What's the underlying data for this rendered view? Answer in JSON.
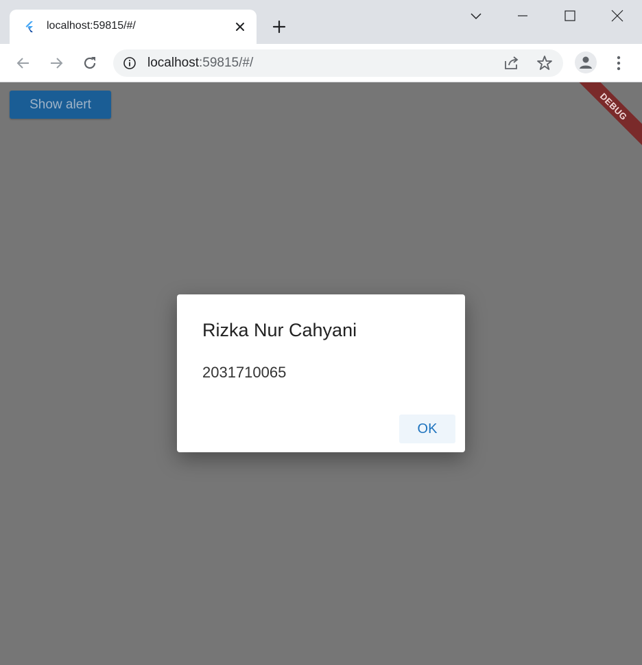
{
  "browser": {
    "tab": {
      "title": "localhost:59815/#/",
      "favicon": "flutter-logo-icon"
    },
    "address": {
      "host": "localhost",
      "rest": ":59815/#/"
    }
  },
  "app": {
    "show_alert_label": "Show alert",
    "debug_banner": "DEBUG"
  },
  "dialog": {
    "title": "Rizka Nur Cahyani",
    "content": "2031710065",
    "ok_label": "OK"
  },
  "colors": {
    "scrim": "#767676",
    "button": "#1a5d95",
    "accent": "#1e73be",
    "debug_banner": "#7a2a2a"
  }
}
